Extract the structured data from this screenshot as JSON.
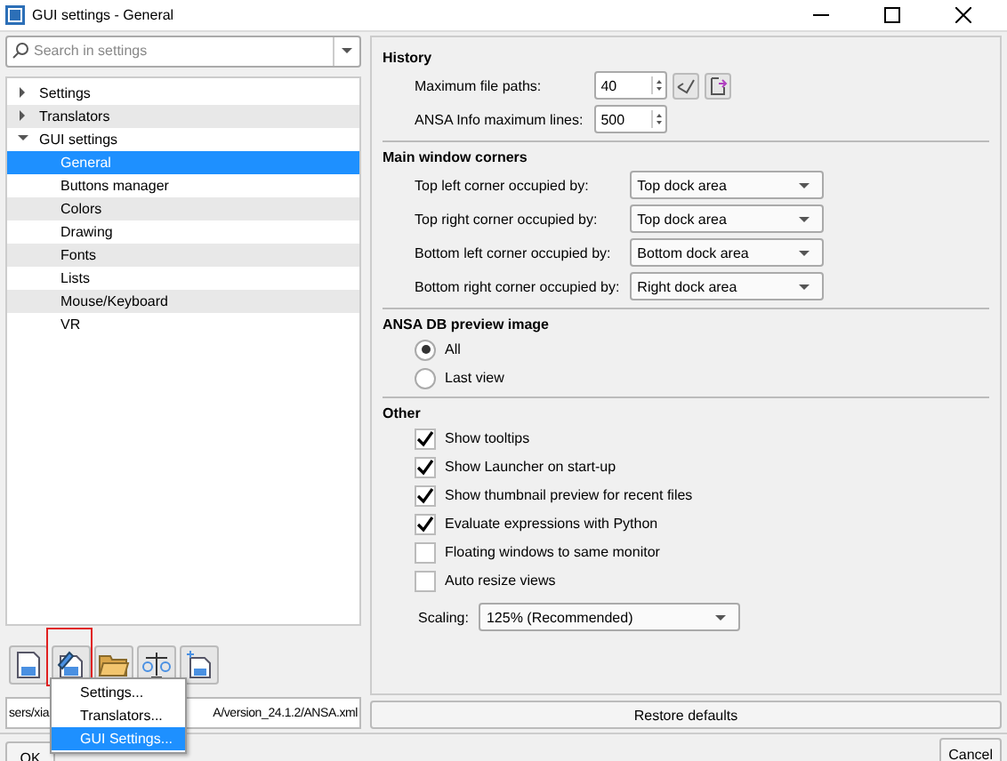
{
  "window": {
    "title": "GUI settings - General"
  },
  "search": {
    "placeholder": "Search in settings"
  },
  "tree": [
    {
      "label": "Settings",
      "expanded": false
    },
    {
      "label": "Translators",
      "expanded": false
    },
    {
      "label": "GUI settings",
      "expanded": true,
      "children": [
        {
          "label": "General",
          "selected": true
        },
        {
          "label": "Buttons manager",
          "selected": false
        },
        {
          "label": "Colors",
          "selected": false
        },
        {
          "label": "Drawing",
          "selected": false
        },
        {
          "label": "Fonts",
          "selected": false
        },
        {
          "label": "Lists",
          "selected": false
        },
        {
          "label": "Mouse/Keyboard",
          "selected": false
        },
        {
          "label": "VR",
          "selected": false
        }
      ]
    }
  ],
  "toolbar": [
    {
      "kind": "save",
      "highlighted": false
    },
    {
      "kind": "edit",
      "highlighted": true
    },
    {
      "kind": "folder",
      "highlighted": false
    },
    {
      "kind": "compare",
      "highlighted": false
    },
    {
      "kind": "new",
      "highlighted": false
    }
  ],
  "path": {
    "start": "sers/xia",
    "end": "A/version_24.1.2/ANSA.xml"
  },
  "menu": [
    {
      "label": "Settings...",
      "selected": false
    },
    {
      "label": "Translators...",
      "selected": false
    },
    {
      "label": "GUI Settings...",
      "selected": true
    }
  ],
  "history": {
    "title": "History",
    "rows": [
      {
        "label": "Maximum file paths:",
        "value": "40"
      },
      {
        "label": "ANSA Info maximum lines:",
        "value": "500"
      }
    ]
  },
  "corners": {
    "title": "Main window corners",
    "rows": [
      {
        "label": "Top left corner occupied by:",
        "value": "Top dock area"
      },
      {
        "label": "Top right corner occupied by:",
        "value": "Top dock area"
      },
      {
        "label": "Bottom left corner occupied by:",
        "value": "Bottom dock area"
      },
      {
        "label": "Bottom right corner occupied by:",
        "value": "Right dock area"
      }
    ]
  },
  "preview": {
    "title": "ANSA DB preview image",
    "options": [
      {
        "label": "All",
        "selected": true
      },
      {
        "label": "Last view",
        "selected": false
      }
    ]
  },
  "other": {
    "title": "Other",
    "options": [
      {
        "label": "Show tooltips",
        "checked": true
      },
      {
        "label": "Show Launcher on start-up",
        "checked": true
      },
      {
        "label": "Show thumbnail preview for recent files",
        "checked": true
      },
      {
        "label": "Evaluate expressions with Python",
        "checked": true
      },
      {
        "label": "Floating windows to same monitor",
        "checked": false
      },
      {
        "label": "Auto resize views",
        "checked": false
      }
    ],
    "scaling": {
      "label": "Scaling:",
      "value": "125% (Recommended)"
    }
  },
  "buttons": {
    "restore": "Restore defaults",
    "ok": "OK",
    "cancel": "Cancel"
  }
}
